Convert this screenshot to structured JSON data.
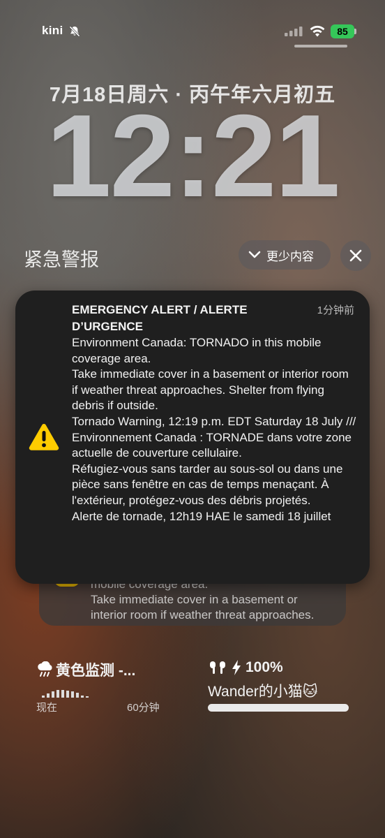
{
  "status_bar": {
    "carrier": "kini",
    "battery_percent": "85",
    "battery_level": 0.85
  },
  "lock_screen": {
    "date": "7月18日周六 · 丙午年六月初五",
    "time": "12:21"
  },
  "notification_center": {
    "title": "紧急警报",
    "show_less_label": "更少内容"
  },
  "alert": {
    "title": "EMERGENCY ALERT / ALERTE D’URGENCE",
    "time_ago": "1分钟前",
    "body": [
      "Environment Canada: TORNADO in this mobile coverage area.",
      "Take immediate cover in a basement or interior room if weather threat approaches. Shelter from flying debris if outside.",
      "Tornado Warning, 12:19 p.m. EDT Saturday 18 July /// Environnement Canada : TORNADE dans votre zone actuelle de couverture cellulaire.",
      "Réfugiez-vous sans tarder au sous-sol ou dans une pièce sans fenêtre en cas de temps menaçant. À l'extérieur, protégez-vous des débris projetés.",
      "Alerte de tornade, 12h19 HAE le samedi 18 juillet"
    ],
    "icon": "warning-triangle-icon",
    "icon_color": "#ffcc00"
  },
  "stacked_alert": {
    "lines": [
      "mobile coverage area.",
      "Take immediate cover in a basement or",
      "interior room if weather threat approaches."
    ]
  },
  "weather_widget": {
    "title": "黄色监测 -...",
    "label_now": "现在",
    "label_60": "60分钟",
    "icon": "rain-cloud-icon"
  },
  "airpods_widget": {
    "battery": "100%",
    "device_name": "Wander的小猫🐱",
    "level": 1.0,
    "icon": "airpods-icon"
  }
}
